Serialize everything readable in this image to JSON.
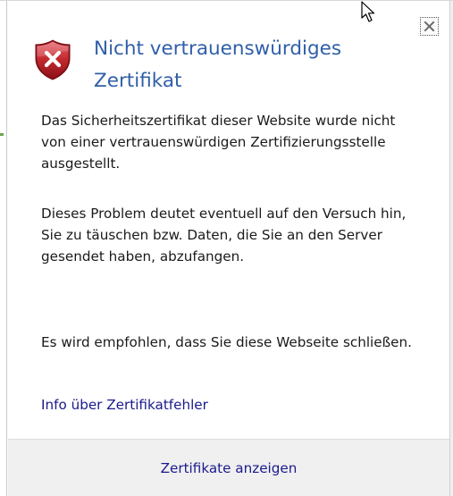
{
  "dialog": {
    "title": "Nicht vertrauenswürdiges Zertifikat",
    "close_symbol": "×",
    "paragraph1": "Das Sicherheitszertifikat dieser Website wurde nicht von einer vertrauenswürdigen Zertifizierungsstelle ausgestellt.",
    "paragraph2": "Dieses Problem deutet eventuell auf den Versuch hin, Sie zu täuschen bzw. Daten, die Sie an den Server gesendet haben, abzufangen.",
    "paragraph3": "Es wird empfohlen, dass Sie diese Webseite schließen.",
    "info_link": "Info über Zertifikatfehler",
    "show_certificates": "Zertifikate anzeigen"
  },
  "icons": {
    "status": "shield-error-icon",
    "close": "close-icon",
    "cursor": "mouse-cursor-icon"
  },
  "colors": {
    "title": "#2f5fa8",
    "link": "#1a1a8c",
    "shield_red": "#c0282d",
    "footer_bg": "#f0f0f0"
  }
}
